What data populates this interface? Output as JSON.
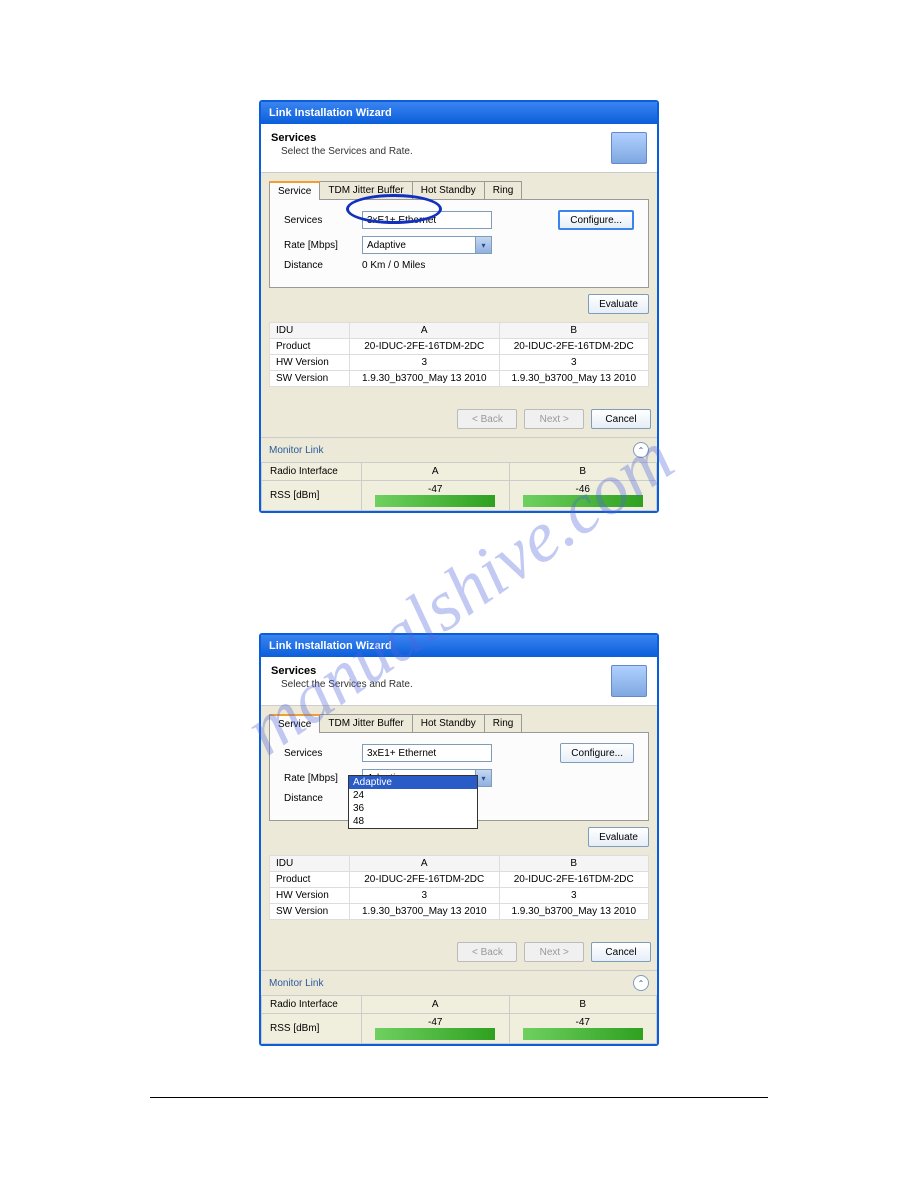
{
  "watermark": "manualshive.com",
  "dialog": {
    "title": "Link Installation Wizard",
    "header_title": "Services",
    "header_sub": "Select the Services and Rate.",
    "tabs": [
      "Service",
      "TDM Jitter Buffer",
      "Hot Standby",
      "Ring"
    ],
    "form": {
      "services_label": "Services",
      "services_value": "3xE1+ Ethernet",
      "rate_label": "Rate [Mbps]",
      "rate_value": "Adaptive",
      "distance_label": "Distance",
      "distance_value": "0 Km / 0 Miles",
      "configure_btn": "Configure...",
      "evaluate_btn": "Evaluate"
    },
    "rate_options": [
      "Adaptive",
      "24",
      "36",
      "48"
    ],
    "table": {
      "headers": [
        "IDU",
        "A",
        "B"
      ],
      "rows": [
        [
          "Product",
          "20-IDUC-2FE-16TDM-2DC",
          "20-IDUC-2FE-16TDM-2DC"
        ],
        [
          "HW Version",
          "3",
          "3"
        ],
        [
          "SW Version",
          "1.9.30_b3700_May 13 2010",
          "1.9.30_b3700_May 13 2010"
        ]
      ]
    },
    "nav": {
      "back": "< Back",
      "next": "Next >",
      "cancel": "Cancel"
    },
    "monitor": {
      "title": "Monitor Link",
      "radio_label": "Radio Interface",
      "col_a": "A",
      "col_b": "B",
      "rss_label": "RSS [dBm]",
      "rss_a_top": "-47",
      "rss_b_top": "-46",
      "rss_a_bot": "-47",
      "rss_b_bot": "-47"
    }
  }
}
